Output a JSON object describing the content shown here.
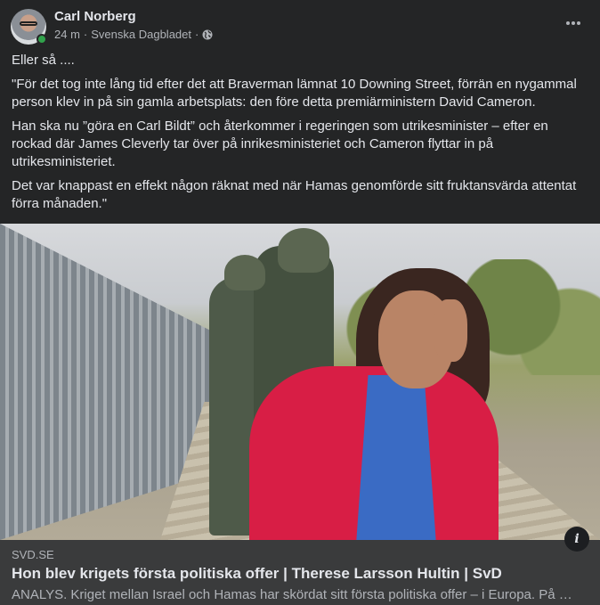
{
  "post": {
    "author": "Carl Norberg",
    "time": "24 m",
    "group": "Svenska Dagbladet",
    "separator": "·",
    "paragraphs": [
      "Eller så ....",
      "\"För det tog inte lång tid efter det att Braverman lämnat 10 Downing Street, förrän en nygammal person klev in på sin gamla arbetsplats: den före detta premiärministern David Cameron.",
      "Han ska nu ”göra en Carl Bildt” och återkommer i regeringen som utrikesminister – efter en rockad där James Cleverly tar över på inrikesministeriet och Cameron flyttar in på utrikesministeriet.",
      "Det var knappast en effekt någon räknat med när Hamas genomförde sitt fruktansvärda attentat förra månaden.\""
    ]
  },
  "link_preview": {
    "domain": "SVD.SE",
    "title": "Hon blev krigets första politiska offer | Therese Larsson Hultin | SvD",
    "description": "ANALYS. Kriget mellan Israel och Hamas har skördat sitt första politiska offer – i Europa. På …",
    "info_glyph": "i"
  },
  "icons": {
    "globe": "globe-icon",
    "more": "more-options-icon",
    "info": "info-icon"
  },
  "colors": {
    "background": "#242526",
    "link_background": "#3a3b3c",
    "online": "#31a24c"
  }
}
